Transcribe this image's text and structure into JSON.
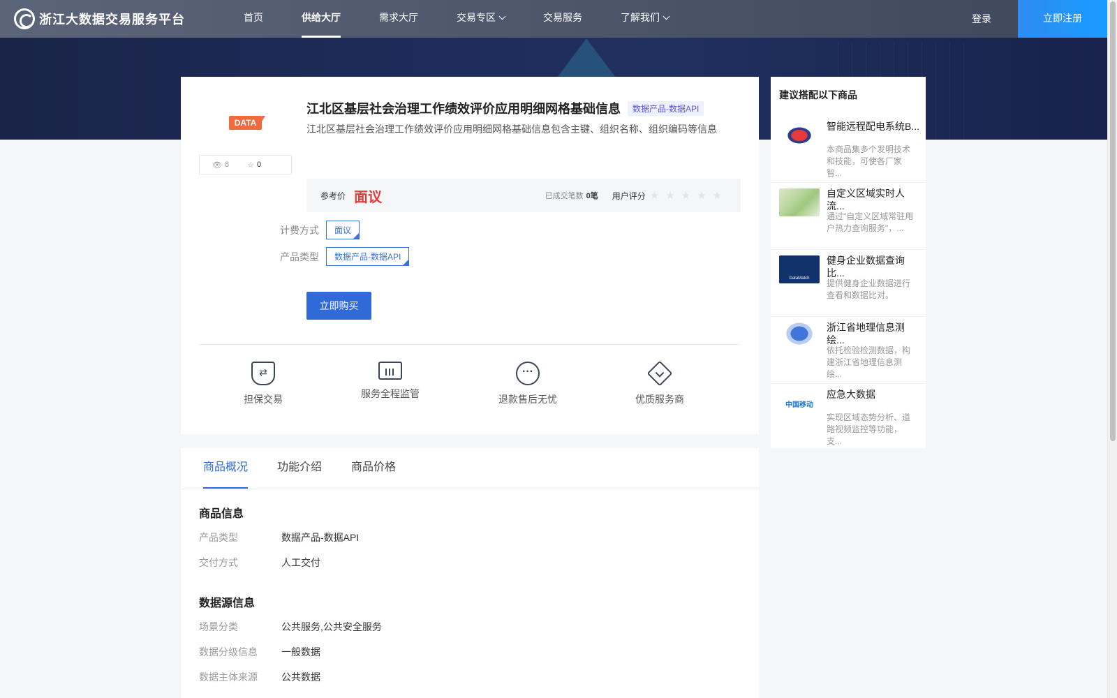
{
  "brand": {
    "name": "浙江大数据交易服务平台"
  },
  "nav": {
    "items": [
      {
        "label": "首页",
        "active": false,
        "dropdown": false
      },
      {
        "label": "供给大厅",
        "active": true,
        "dropdown": false
      },
      {
        "label": "需求大厅",
        "active": false,
        "dropdown": false
      },
      {
        "label": "交易专区",
        "active": false,
        "dropdown": true
      },
      {
        "label": "交易服务",
        "active": false,
        "dropdown": false
      },
      {
        "label": "了解我们",
        "active": false,
        "dropdown": true
      }
    ],
    "login": "登录",
    "register": "立即注册"
  },
  "product": {
    "thumb_tag": "DATA",
    "views": "8",
    "favorites": "0",
    "title": "江北区基层社会治理工作绩效评价应用明细网格基础信息",
    "type_badge": "数据产品-数据API",
    "description": "江北区基层社会治理工作绩效评价应用明细网格基础信息包含主键、组织名称、组织编码等信息",
    "price_label": "参考价",
    "price": "面议",
    "deals_label": "已成交笔数",
    "deals_value": "0笔",
    "rating_label": "用户评分",
    "rating": 0,
    "billing_label": "计费方式",
    "billing_value": "面议",
    "type_label": "产品类型",
    "type_value": "数据产品-数据API",
    "buy_button": "立即购买"
  },
  "guarantees": [
    "担保交易",
    "服务全程监管",
    "退款售后无忧",
    "优质服务商"
  ],
  "side": {
    "title": "建议搭配以下商品",
    "items": [
      {
        "name": "智能远程配电系统B...",
        "desc": "本商品集多个发明技术和技能，可使各厂家智..."
      },
      {
        "name": "自定义区域实时人流...",
        "desc": "通过\"自定义区域常驻用户热力查询服务\"，..."
      },
      {
        "name": "健身企业数据查询比...",
        "desc": "提供健身企业数据进行查看和数据比对。"
      },
      {
        "name": "浙江省地理信息测绘...",
        "desc": "依托检验检测数据，构建浙江省地理信息测绘..."
      },
      {
        "name": "应急大数据",
        "desc": "实现区域态势分析、道路视频监控等功能，支..."
      }
    ],
    "image_texts": [
      "DataMatch",
      "中国移动"
    ]
  },
  "tabs": [
    "商品概况",
    "功能介绍",
    "商品价格"
  ],
  "info": {
    "section1_title": "商品信息",
    "section1_rows": [
      {
        "k": "产品类型",
        "v": "数据产品-数据API"
      },
      {
        "k": "交付方式",
        "v": "人工交付"
      }
    ],
    "section2_title": "数据源信息",
    "section2_rows": [
      {
        "k": "场景分类",
        "v": "公共服务,公共安全服务"
      },
      {
        "k": "数据分级信息",
        "v": "一般数据"
      },
      {
        "k": "数据主体来源",
        "v": "公共数据"
      }
    ]
  }
}
